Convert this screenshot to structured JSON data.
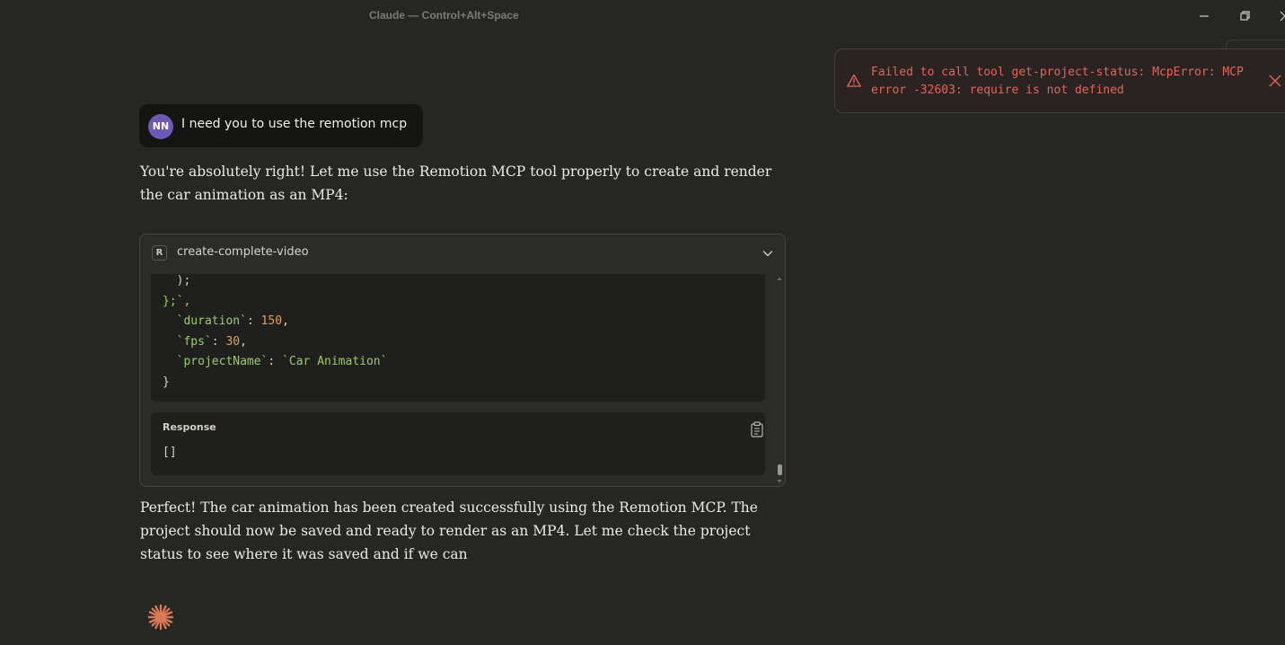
{
  "window": {
    "title": "Claude — Control+Alt+Space",
    "controls": {
      "minimize": "minimize-icon",
      "restore": "restore-icon",
      "close": "close-icon"
    }
  },
  "toast": {
    "message": "Failed to call tool get-project-status: McpError: MCP error -32603: require is not defined",
    "icon": "warning-icon",
    "color": "#e0665b"
  },
  "user_message": {
    "avatar_initials": "NN",
    "avatar_color": "#6c5ab5",
    "text": "I need you to use the remotion mcp"
  },
  "assistant": {
    "intro": "You're absolutely right! Let me use the Remotion MCP tool properly to create and render the car animation as an MP4:",
    "tool_call": {
      "badge": "R",
      "name": "create-complete-video",
      "code_lines": [
        "  );",
        "};`,",
        "  `duration`: 150,",
        "  `fps`: 30,",
        "  `projectName`: `Car Animation`",
        "}"
      ],
      "response_label": "Response",
      "response_value": "[]"
    },
    "followup": "Perfect! The car animation has been created successfully using the Remotion MCP. The project should now be saved and ready to render as an MP4. Let me check the project status to see where it was saved and if we can",
    "loading_icon": "claude-spark-icon",
    "accent_color": "#d97757"
  }
}
